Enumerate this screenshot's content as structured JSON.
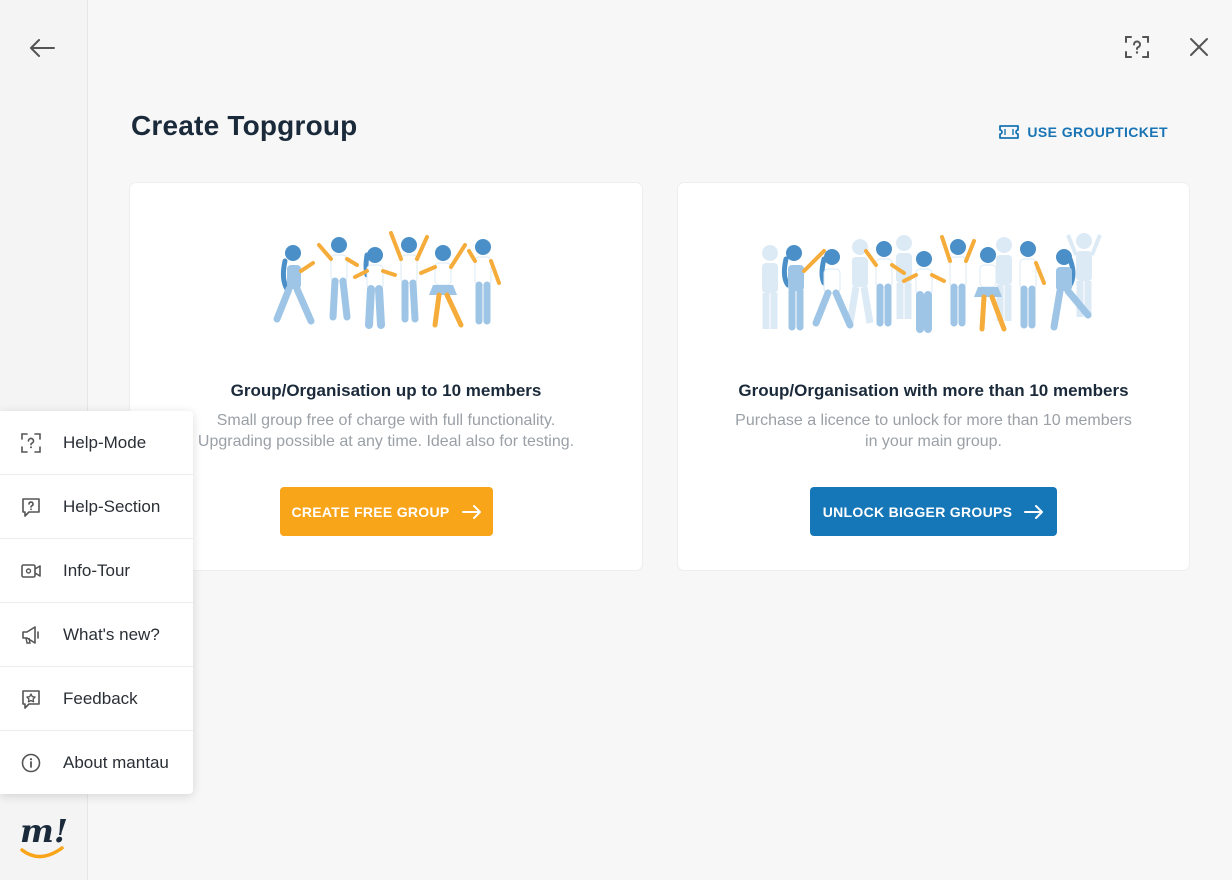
{
  "header": {
    "title": "Create Topgroup",
    "groupticket_label": "USE GROUPTICKET"
  },
  "cards": [
    {
      "title": "Group/Organisation up to 10 members",
      "description": "Small group free of charge with full functionality.\nUpgrading possible at any time. Ideal also for testing.",
      "button_label": "CREATE FREE GROUP"
    },
    {
      "title": "Group/Organisation with more than 10 members",
      "description": "Purchase a licence to unlock for more than 10 members\nin your main group.",
      "button_label": "UNLOCK BIGGER GROUPS"
    }
  ],
  "help_menu": {
    "items": [
      {
        "label": "Help-Mode",
        "icon": "help-mode-icon"
      },
      {
        "label": "Help-Section",
        "icon": "help-section-icon"
      },
      {
        "label": "Info-Tour",
        "icon": "info-tour-icon"
      },
      {
        "label": "What's new?",
        "icon": "megaphone-icon"
      },
      {
        "label": "Feedback",
        "icon": "feedback-icon"
      },
      {
        "label": "About mantau",
        "icon": "info-icon"
      }
    ]
  },
  "logo_text": "m!",
  "colors": {
    "accent_orange": "#f8a51a",
    "primary_blue": "#1677b8",
    "link_blue": "#1874b5",
    "background": "#f7f7f7"
  }
}
